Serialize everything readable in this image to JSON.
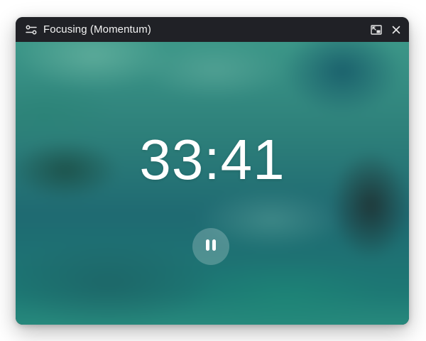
{
  "window": {
    "title": "Focusing (Momentum)"
  },
  "timer": {
    "display": "33:41",
    "state": "running"
  },
  "controls": {
    "primary_action_icon": "pause-icon"
  },
  "titlebar_icons": {
    "left": "settings-sliders-icon",
    "right": [
      "exit-fullscreen-icon",
      "close-icon"
    ]
  }
}
